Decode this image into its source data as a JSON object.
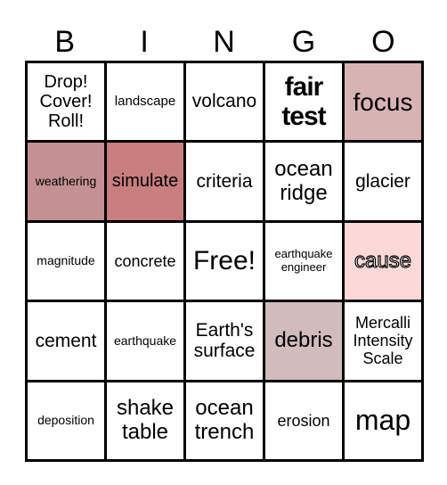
{
  "header": [
    "B",
    "I",
    "N",
    "G",
    "O"
  ],
  "cells": [
    {
      "text": "Drop! Cover! Roll!",
      "bg": "#ffffff"
    },
    {
      "text": "landscape",
      "bg": "#ffffff"
    },
    {
      "text": "volcano",
      "bg": "#ffffff"
    },
    {
      "text": "fair test",
      "bg": "#ffffff"
    },
    {
      "text": "focus",
      "bg": "#d8b3b4"
    },
    {
      "text": "weathering",
      "bg": "#c49193"
    },
    {
      "text": "simulate",
      "bg": "#c97e7f"
    },
    {
      "text": "criteria",
      "bg": "#ffffff"
    },
    {
      "text": "ocean ridge",
      "bg": "#ffffff"
    },
    {
      "text": "glacier",
      "bg": "#ffffff"
    },
    {
      "text": "magnitude",
      "bg": "#ffffff"
    },
    {
      "text": "concrete",
      "bg": "#ffffff"
    },
    {
      "text": "Free!",
      "bg": "#ffffff"
    },
    {
      "text": "earthquake engineer",
      "bg": "#ffffff"
    },
    {
      "text": "cause",
      "bg": "#fcd8d8"
    },
    {
      "text": "cement",
      "bg": "#ffffff"
    },
    {
      "text": "earthquake",
      "bg": "#ffffff"
    },
    {
      "text": "Earth's surface",
      "bg": "#ffffff"
    },
    {
      "text": "debris",
      "bg": "#d1bbbc"
    },
    {
      "text": "Mercalli Intensity Scale",
      "bg": "#ffffff"
    },
    {
      "text": "deposition",
      "bg": "#ffffff"
    },
    {
      "text": "shake table",
      "bg": "#ffffff"
    },
    {
      "text": "ocean trench",
      "bg": "#ffffff"
    },
    {
      "text": "erosion",
      "bg": "#ffffff"
    },
    {
      "text": "map",
      "bg": "#ffffff"
    }
  ]
}
